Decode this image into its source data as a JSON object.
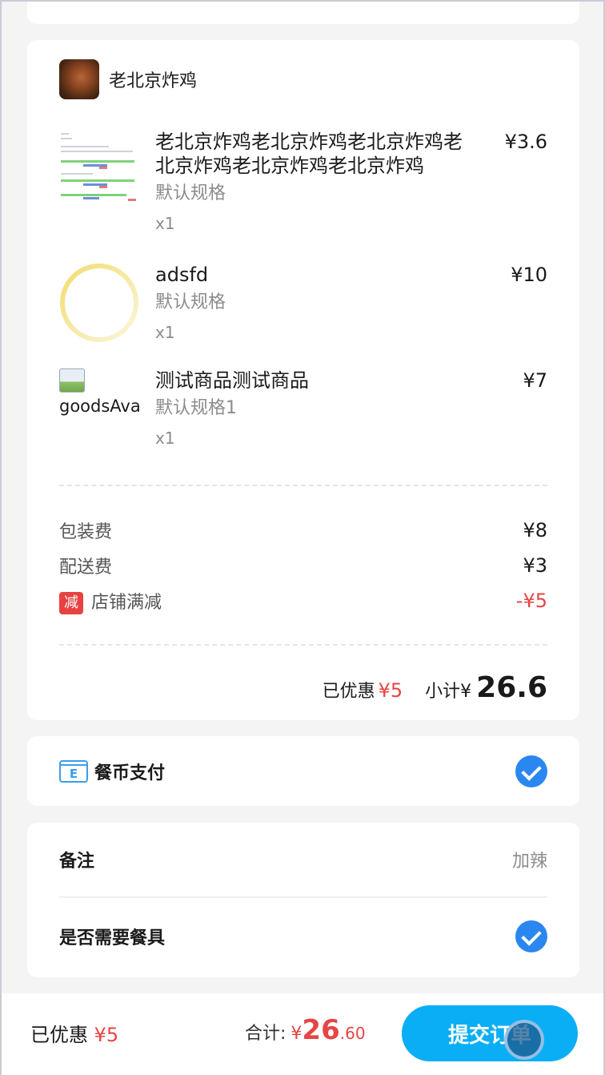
{
  "shop": {
    "name": "老北京炸鸡"
  },
  "goods": [
    {
      "name": "老北京炸鸡老北京炸鸡老北京炸鸡老北京炸鸡老北京炸鸡老北京炸鸡",
      "spec": "默认规格",
      "qty": "x1",
      "price": "¥3.6"
    },
    {
      "name": "adsfd",
      "spec": "默认规格",
      "qty": "x1",
      "price": "¥10"
    },
    {
      "name": "测试商品测试商品",
      "spec": "默认规格1",
      "qty": "x1",
      "price": "¥7",
      "img_alt": "goodsAvatar"
    }
  ],
  "fees": {
    "packing": {
      "label": "包装费",
      "value": "¥8"
    },
    "delivery": {
      "label": "配送费",
      "value": "¥3"
    },
    "shop_discount": {
      "badge": "减",
      "label": "店铺满减",
      "value": "-¥5"
    }
  },
  "subtotal": {
    "discount_label": "已优惠",
    "discount_value": "¥5",
    "label": "小计",
    "currency": "¥",
    "value": "26.6"
  },
  "payment": {
    "label": "餐币支付",
    "icon_letter": "E"
  },
  "note": {
    "label": "备注",
    "value": "加辣"
  },
  "tableware": {
    "label": "是否需要餐具"
  },
  "bottom_bar": {
    "discount_label": "已优惠",
    "discount_value": "¥5",
    "total_label": "合计:",
    "total_currency": "¥",
    "total_int": "26",
    "total_dec": ".60",
    "submit_label": "提交订单"
  },
  "colors": {
    "accent": "#0aaef5",
    "price_red": "#e64545",
    "check_blue": "#2b87f0"
  }
}
